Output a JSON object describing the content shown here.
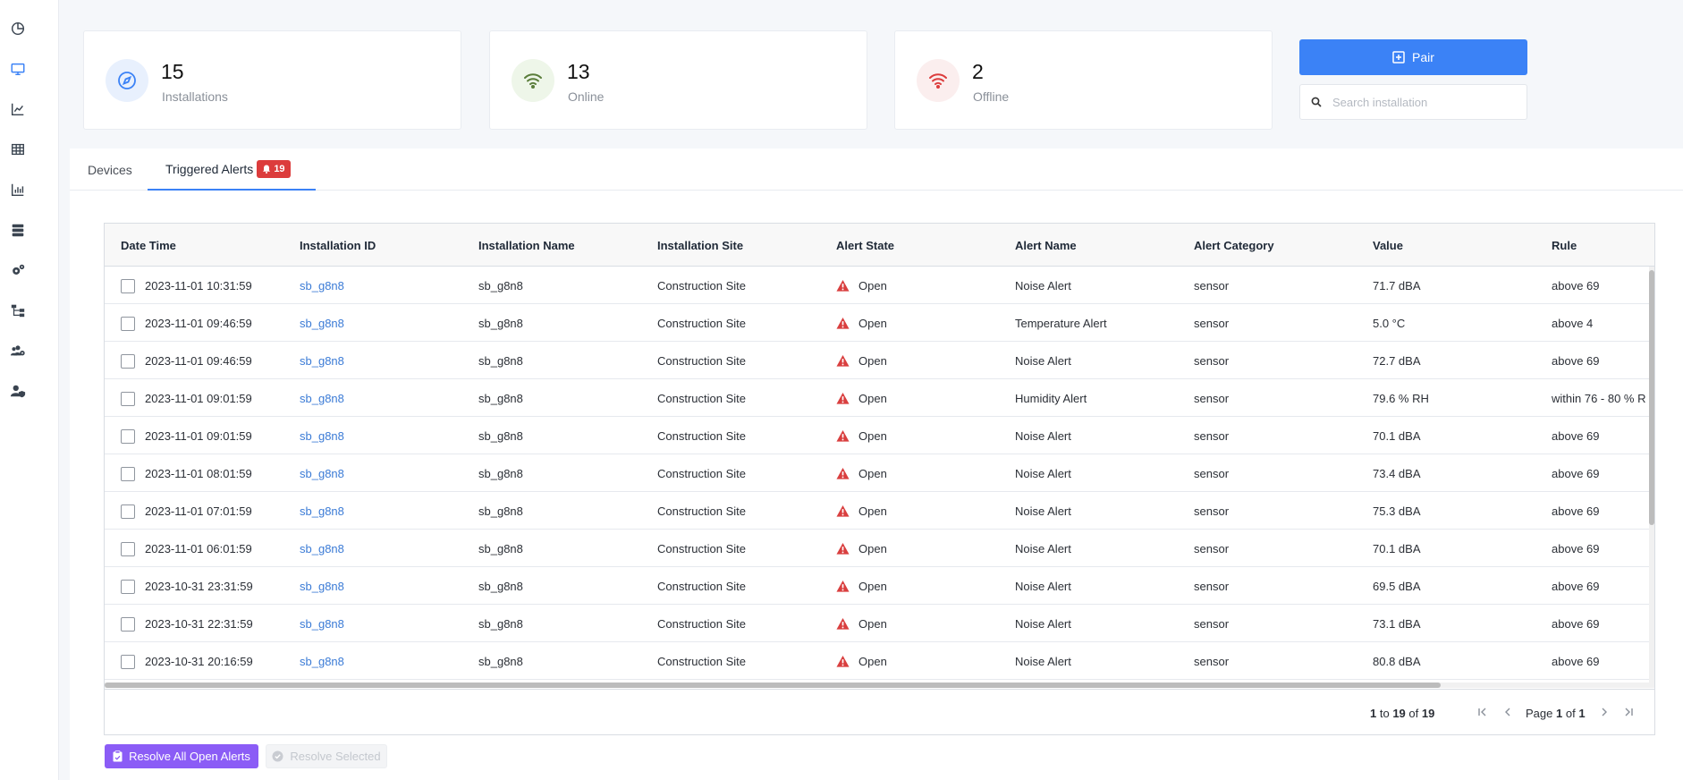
{
  "sidebar": {
    "items": [
      {
        "name": "dashboard",
        "icon": "pie-chart-icon"
      },
      {
        "name": "devices",
        "icon": "monitor-icon",
        "active": true
      },
      {
        "name": "analytics",
        "icon": "line-chart-icon"
      },
      {
        "name": "table",
        "icon": "table-icon"
      },
      {
        "name": "reports",
        "icon": "bar-chart-icon"
      },
      {
        "name": "servers",
        "icon": "server-icon"
      },
      {
        "name": "settings",
        "icon": "gears-icon"
      },
      {
        "name": "hierarchy",
        "icon": "sitemap-icon"
      },
      {
        "name": "users",
        "icon": "users-cog-icon"
      },
      {
        "name": "user-security",
        "icon": "user-shield-icon"
      }
    ]
  },
  "stats": {
    "installations": {
      "count": "15",
      "label": "Installations",
      "icon": "compass-icon",
      "color": "#3b82f6"
    },
    "online": {
      "count": "13",
      "label": "Online",
      "icon": "wifi-icon",
      "color": "#5a7d3a"
    },
    "offline": {
      "count": "2",
      "label": "Offline",
      "icon": "wifi-icon",
      "color": "#dc3c3c"
    }
  },
  "actions": {
    "pair_label": "Pair",
    "search_placeholder": "Search installation"
  },
  "tabs": [
    {
      "label": "Devices",
      "active": false
    },
    {
      "label": "Triggered Alerts",
      "active": true,
      "badge": "19"
    }
  ],
  "grid": {
    "columns": [
      "Date Time",
      "Installation ID",
      "Installation Name",
      "Installation Site",
      "Alert State",
      "Alert Name",
      "Alert Category",
      "Value",
      "Rule"
    ],
    "rows": [
      {
        "datetime": "2023-11-01 10:31:59",
        "inst_id": "sb_g8n8",
        "inst_name": "sb_g8n8",
        "site": "Construction Site",
        "state": "Open",
        "alert": "Noise Alert",
        "category": "sensor",
        "value": "71.7 dBA",
        "rule": "above 69"
      },
      {
        "datetime": "2023-11-01 09:46:59",
        "inst_id": "sb_g8n8",
        "inst_name": "sb_g8n8",
        "site": "Construction Site",
        "state": "Open",
        "alert": "Temperature Alert",
        "category": "sensor",
        "value": "5.0 °C",
        "rule": "above 4"
      },
      {
        "datetime": "2023-11-01 09:46:59",
        "inst_id": "sb_g8n8",
        "inst_name": "sb_g8n8",
        "site": "Construction Site",
        "state": "Open",
        "alert": "Noise Alert",
        "category": "sensor",
        "value": "72.7 dBA",
        "rule": "above 69"
      },
      {
        "datetime": "2023-11-01 09:01:59",
        "inst_id": "sb_g8n8",
        "inst_name": "sb_g8n8",
        "site": "Construction Site",
        "state": "Open",
        "alert": "Humidity Alert",
        "category": "sensor",
        "value": "79.6 % RH",
        "rule": "within 76 - 80 % R"
      },
      {
        "datetime": "2023-11-01 09:01:59",
        "inst_id": "sb_g8n8",
        "inst_name": "sb_g8n8",
        "site": "Construction Site",
        "state": "Open",
        "alert": "Noise Alert",
        "category": "sensor",
        "value": "70.1 dBA",
        "rule": "above 69"
      },
      {
        "datetime": "2023-11-01 08:01:59",
        "inst_id": "sb_g8n8",
        "inst_name": "sb_g8n8",
        "site": "Construction Site",
        "state": "Open",
        "alert": "Noise Alert",
        "category": "sensor",
        "value": "73.4 dBA",
        "rule": "above 69"
      },
      {
        "datetime": "2023-11-01 07:01:59",
        "inst_id": "sb_g8n8",
        "inst_name": "sb_g8n8",
        "site": "Construction Site",
        "state": "Open",
        "alert": "Noise Alert",
        "category": "sensor",
        "value": "75.3 dBA",
        "rule": "above 69"
      },
      {
        "datetime": "2023-11-01 06:01:59",
        "inst_id": "sb_g8n8",
        "inst_name": "sb_g8n8",
        "site": "Construction Site",
        "state": "Open",
        "alert": "Noise Alert",
        "category": "sensor",
        "value": "70.1 dBA",
        "rule": "above 69"
      },
      {
        "datetime": "2023-10-31 23:31:59",
        "inst_id": "sb_g8n8",
        "inst_name": "sb_g8n8",
        "site": "Construction Site",
        "state": "Open",
        "alert": "Noise Alert",
        "category": "sensor",
        "value": "69.5 dBA",
        "rule": "above 69"
      },
      {
        "datetime": "2023-10-31 22:31:59",
        "inst_id": "sb_g8n8",
        "inst_name": "sb_g8n8",
        "site": "Construction Site",
        "state": "Open",
        "alert": "Noise Alert",
        "category": "sensor",
        "value": "73.1 dBA",
        "rule": "above 69"
      },
      {
        "datetime": "2023-10-31 20:16:59",
        "inst_id": "sb_g8n8",
        "inst_name": "sb_g8n8",
        "site": "Construction Site",
        "state": "Open",
        "alert": "Noise Alert",
        "category": "sensor",
        "value": "80.8 dBA",
        "rule": "above 69"
      }
    ],
    "alert_color": "#d93f3f"
  },
  "pagination": {
    "from": "1",
    "to_word": "to",
    "to": "19",
    "of_word": "of",
    "total": "19",
    "page_word": "Page",
    "page": "1",
    "page_of_word": "of",
    "pages": "1"
  },
  "footer": {
    "resolve_all_label": "Resolve All Open Alerts",
    "resolve_selected_label": "Resolve Selected"
  }
}
